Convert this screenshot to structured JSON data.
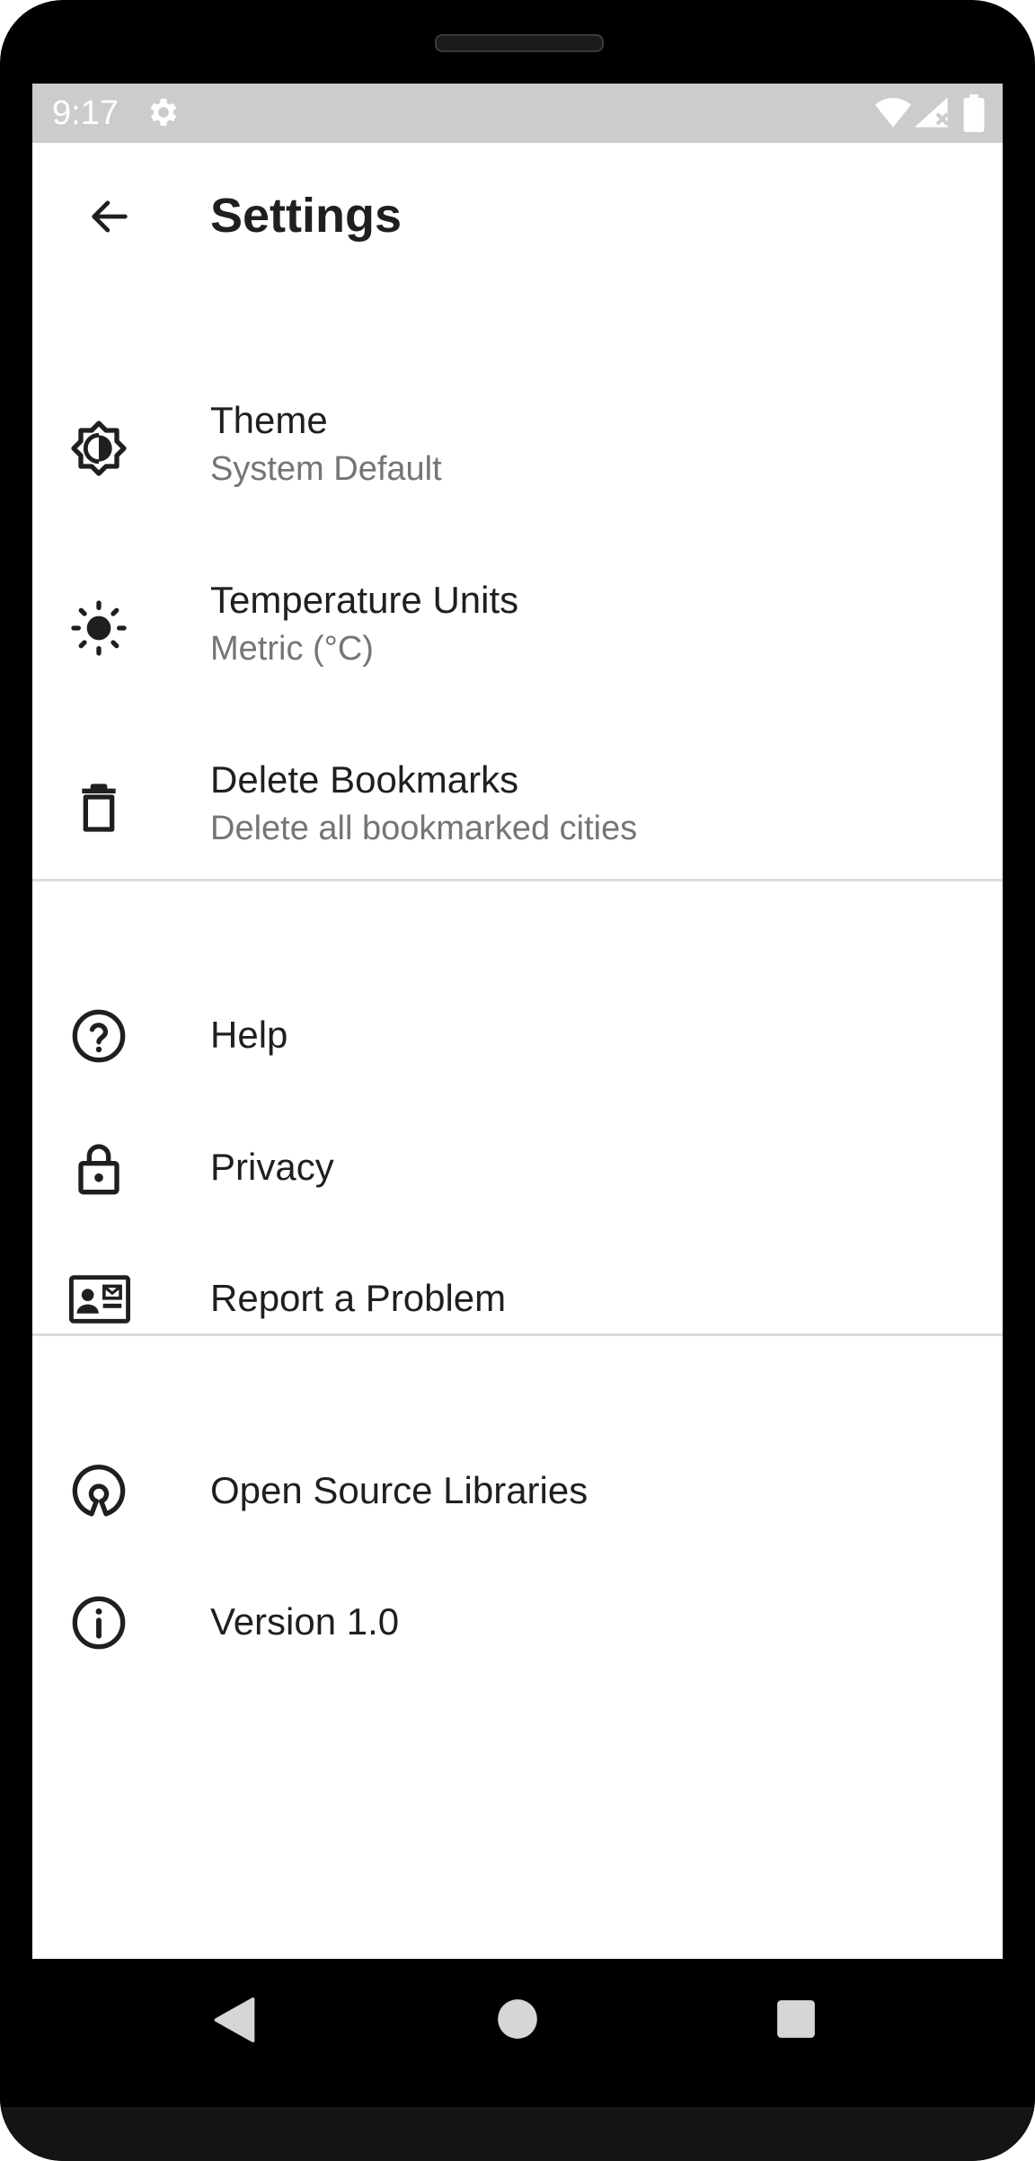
{
  "status_bar": {
    "time": "9:17",
    "icons": [
      "gear-icon",
      "wifi-icon",
      "signal-icon",
      "battery-icon"
    ]
  },
  "app_bar": {
    "back_icon": "arrow-left-icon",
    "title": "Settings"
  },
  "sections": [
    {
      "items": [
        {
          "icon": "theme-brightness-icon",
          "title": "Theme",
          "subtitle": "System Default"
        },
        {
          "icon": "sun-icon",
          "title": "Temperature Units",
          "subtitle": "Metric (°C)"
        },
        {
          "icon": "trash-icon",
          "title": "Delete Bookmarks",
          "subtitle": "Delete all bookmarked cities"
        }
      ]
    },
    {
      "items": [
        {
          "icon": "help-circle-icon",
          "title": "Help"
        },
        {
          "icon": "lock-icon",
          "title": "Privacy"
        },
        {
          "icon": "contact-card-icon",
          "title": "Report a Problem"
        }
      ]
    },
    {
      "items": [
        {
          "icon": "open-source-icon",
          "title": "Open Source Libraries"
        },
        {
          "icon": "info-icon",
          "title": "Version 1.0"
        }
      ]
    }
  ],
  "nav_bar": {
    "icons": [
      "back-triangle-icon",
      "home-circle-icon",
      "recents-square-icon"
    ]
  },
  "colors": {
    "status_bar": "#cccccc",
    "text_primary": "#1f1f1f",
    "text_secondary": "#757575",
    "divider": "#dcdcdc"
  }
}
